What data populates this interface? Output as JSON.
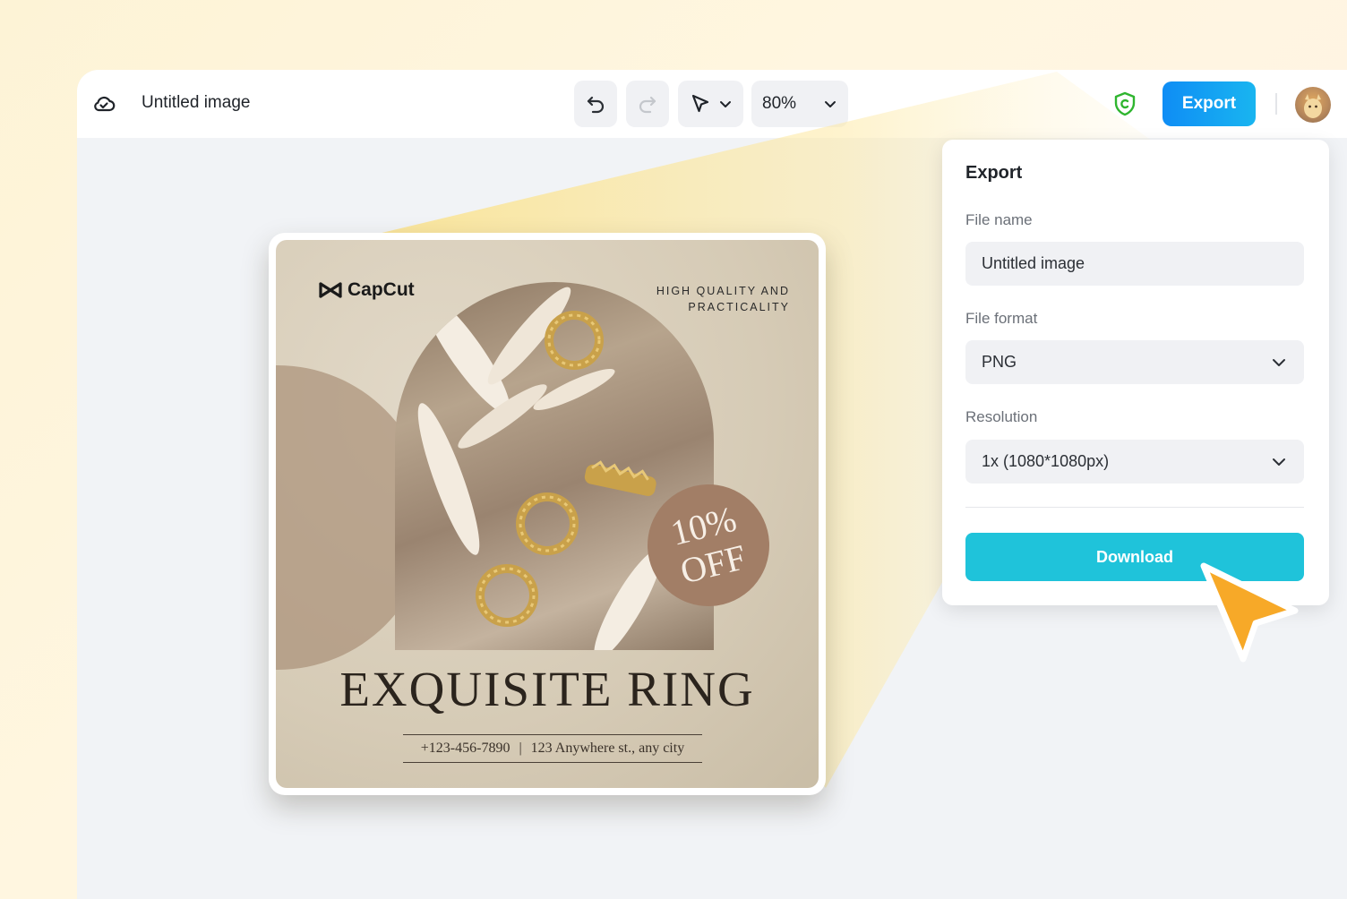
{
  "header": {
    "title": "Untitled image",
    "zoom": "80%",
    "export_label": "Export"
  },
  "poster": {
    "brand": "CapCut",
    "tagline_line1": "HIGH QUALITY AND",
    "tagline_line2": "PRACTICALITY",
    "badge_line1": "10%",
    "badge_line2": "OFF",
    "title": "EXQUISITE RING",
    "phone": "+123-456-7890",
    "separator": "|",
    "address": "123 Anywhere st., any city"
  },
  "export_panel": {
    "title": "Export",
    "file_name_label": "File name",
    "file_name_value": "Untitled image",
    "file_format_label": "File format",
    "file_format_value": "PNG",
    "resolution_label": "Resolution",
    "resolution_value": "1x (1080*1080px)",
    "download_label": "Download"
  },
  "colors": {
    "export_button": "#0f8df5",
    "download_button": "#1fc3da",
    "shield": "#2fb52f",
    "cursor": "#f7a928",
    "badge": "#a27e66"
  }
}
